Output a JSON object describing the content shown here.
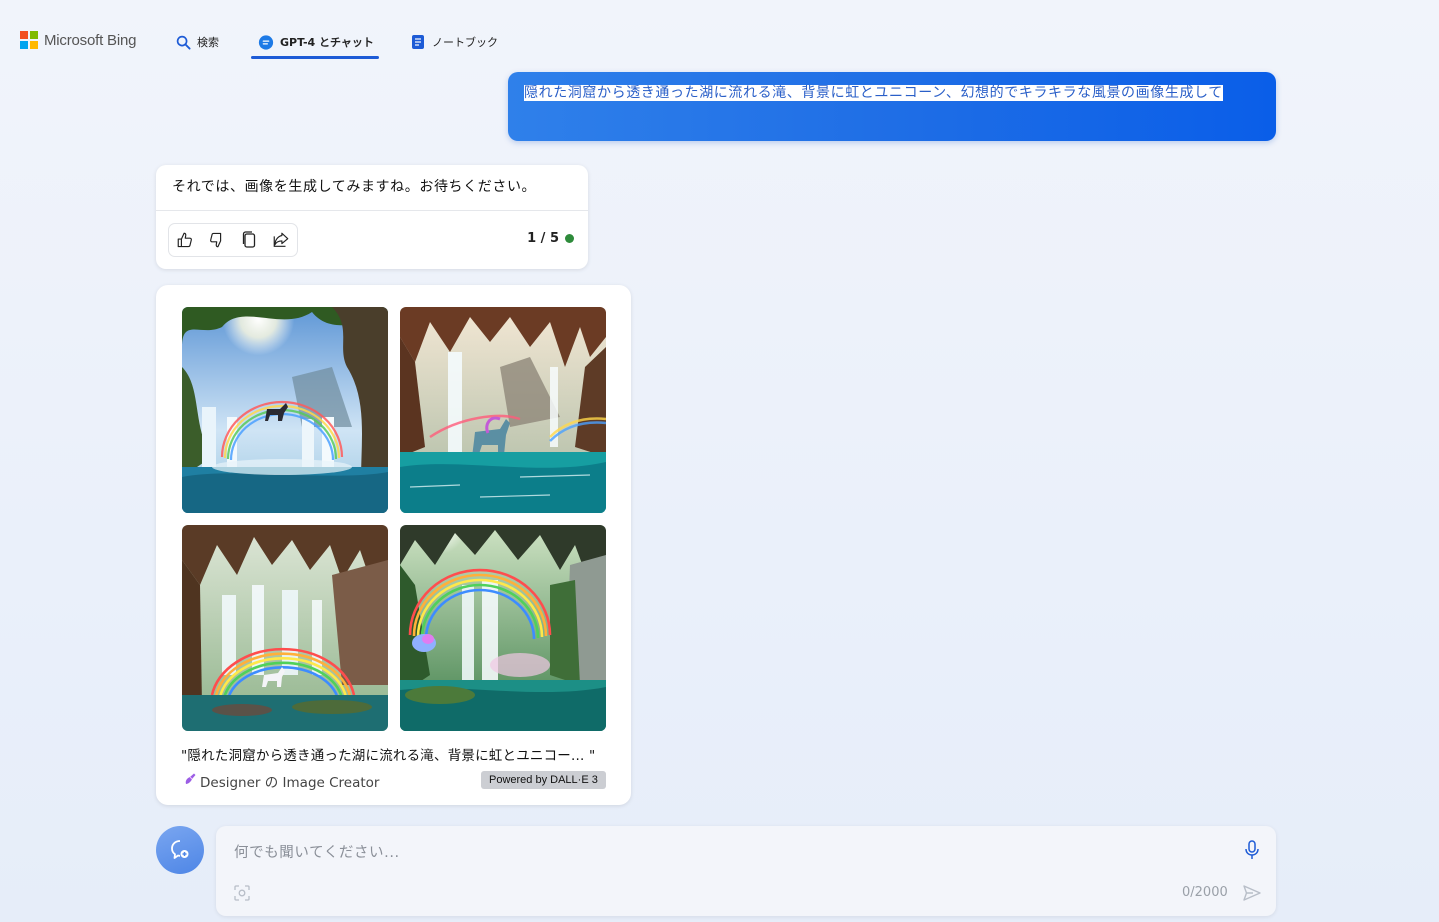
{
  "header": {
    "logo_text": "Microsoft Bing",
    "tabs": [
      {
        "label": "検索",
        "icon": "search-icon",
        "active": false
      },
      {
        "label": "GPT-4 とチャット",
        "icon": "chat-icon",
        "active": true
      },
      {
        "label": "ノートブック",
        "icon": "notebook-icon",
        "active": false
      }
    ]
  },
  "conversation": {
    "user_message": "隠れた洞窟から透き通った湖に流れる滝、背景に虹とユニコーン、幻想的でキラキラな風景の画像生成して",
    "assistant_message": "それでは、画像を生成してみますね。お待ちください。",
    "response_counter": "1 / 5",
    "status_color": "#2e8b3b",
    "feedback_icons": [
      "thumbs-up-icon",
      "thumbs-down-icon",
      "copy-icon",
      "share-icon"
    ]
  },
  "image_result": {
    "images": [
      {
        "icon": "waterfall-image-1"
      },
      {
        "icon": "waterfall-image-2"
      },
      {
        "icon": "waterfall-image-3"
      },
      {
        "icon": "waterfall-image-4"
      }
    ],
    "caption": "\"隠れた洞窟から透き通った湖に流れる滝、背景に虹とユニコー... \"",
    "attribution": "Designer の Image Creator",
    "powered_by": "Powered by DALL·E 3"
  },
  "composer": {
    "placeholder": "何でも聞いてください...",
    "char_count": "0/2000"
  },
  "colors": {
    "accent": "#1d5bd6",
    "user_bubble": "#1f6ee6"
  }
}
